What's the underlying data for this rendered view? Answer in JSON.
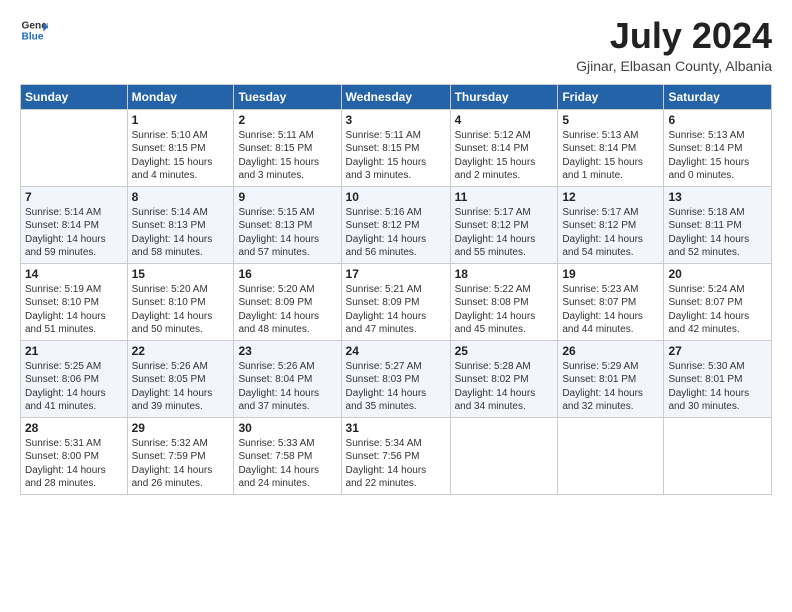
{
  "header": {
    "logo_general": "General",
    "logo_blue": "Blue",
    "month_year": "July 2024",
    "location": "Gjinar, Elbasan County, Albania"
  },
  "weekdays": [
    "Sunday",
    "Monday",
    "Tuesday",
    "Wednesday",
    "Thursday",
    "Friday",
    "Saturday"
  ],
  "weeks": [
    [
      {
        "day": "",
        "sunrise": "",
        "sunset": "",
        "daylight": ""
      },
      {
        "day": "1",
        "sunrise": "Sunrise: 5:10 AM",
        "sunset": "Sunset: 8:15 PM",
        "daylight": "Daylight: 15 hours and 4 minutes."
      },
      {
        "day": "2",
        "sunrise": "Sunrise: 5:11 AM",
        "sunset": "Sunset: 8:15 PM",
        "daylight": "Daylight: 15 hours and 3 minutes."
      },
      {
        "day": "3",
        "sunrise": "Sunrise: 5:11 AM",
        "sunset": "Sunset: 8:15 PM",
        "daylight": "Daylight: 15 hours and 3 minutes."
      },
      {
        "day": "4",
        "sunrise": "Sunrise: 5:12 AM",
        "sunset": "Sunset: 8:14 PM",
        "daylight": "Daylight: 15 hours and 2 minutes."
      },
      {
        "day": "5",
        "sunrise": "Sunrise: 5:13 AM",
        "sunset": "Sunset: 8:14 PM",
        "daylight": "Daylight: 15 hours and 1 minute."
      },
      {
        "day": "6",
        "sunrise": "Sunrise: 5:13 AM",
        "sunset": "Sunset: 8:14 PM",
        "daylight": "Daylight: 15 hours and 0 minutes."
      }
    ],
    [
      {
        "day": "7",
        "sunrise": "Sunrise: 5:14 AM",
        "sunset": "Sunset: 8:14 PM",
        "daylight": "Daylight: 14 hours and 59 minutes."
      },
      {
        "day": "8",
        "sunrise": "Sunrise: 5:14 AM",
        "sunset": "Sunset: 8:13 PM",
        "daylight": "Daylight: 14 hours and 58 minutes."
      },
      {
        "day": "9",
        "sunrise": "Sunrise: 5:15 AM",
        "sunset": "Sunset: 8:13 PM",
        "daylight": "Daylight: 14 hours and 57 minutes."
      },
      {
        "day": "10",
        "sunrise": "Sunrise: 5:16 AM",
        "sunset": "Sunset: 8:12 PM",
        "daylight": "Daylight: 14 hours and 56 minutes."
      },
      {
        "day": "11",
        "sunrise": "Sunrise: 5:17 AM",
        "sunset": "Sunset: 8:12 PM",
        "daylight": "Daylight: 14 hours and 55 minutes."
      },
      {
        "day": "12",
        "sunrise": "Sunrise: 5:17 AM",
        "sunset": "Sunset: 8:12 PM",
        "daylight": "Daylight: 14 hours and 54 minutes."
      },
      {
        "day": "13",
        "sunrise": "Sunrise: 5:18 AM",
        "sunset": "Sunset: 8:11 PM",
        "daylight": "Daylight: 14 hours and 52 minutes."
      }
    ],
    [
      {
        "day": "14",
        "sunrise": "Sunrise: 5:19 AM",
        "sunset": "Sunset: 8:10 PM",
        "daylight": "Daylight: 14 hours and 51 minutes."
      },
      {
        "day": "15",
        "sunrise": "Sunrise: 5:20 AM",
        "sunset": "Sunset: 8:10 PM",
        "daylight": "Daylight: 14 hours and 50 minutes."
      },
      {
        "day": "16",
        "sunrise": "Sunrise: 5:20 AM",
        "sunset": "Sunset: 8:09 PM",
        "daylight": "Daylight: 14 hours and 48 minutes."
      },
      {
        "day": "17",
        "sunrise": "Sunrise: 5:21 AM",
        "sunset": "Sunset: 8:09 PM",
        "daylight": "Daylight: 14 hours and 47 minutes."
      },
      {
        "day": "18",
        "sunrise": "Sunrise: 5:22 AM",
        "sunset": "Sunset: 8:08 PM",
        "daylight": "Daylight: 14 hours and 45 minutes."
      },
      {
        "day": "19",
        "sunrise": "Sunrise: 5:23 AM",
        "sunset": "Sunset: 8:07 PM",
        "daylight": "Daylight: 14 hours and 44 minutes."
      },
      {
        "day": "20",
        "sunrise": "Sunrise: 5:24 AM",
        "sunset": "Sunset: 8:07 PM",
        "daylight": "Daylight: 14 hours and 42 minutes."
      }
    ],
    [
      {
        "day": "21",
        "sunrise": "Sunrise: 5:25 AM",
        "sunset": "Sunset: 8:06 PM",
        "daylight": "Daylight: 14 hours and 41 minutes."
      },
      {
        "day": "22",
        "sunrise": "Sunrise: 5:26 AM",
        "sunset": "Sunset: 8:05 PM",
        "daylight": "Daylight: 14 hours and 39 minutes."
      },
      {
        "day": "23",
        "sunrise": "Sunrise: 5:26 AM",
        "sunset": "Sunset: 8:04 PM",
        "daylight": "Daylight: 14 hours and 37 minutes."
      },
      {
        "day": "24",
        "sunrise": "Sunrise: 5:27 AM",
        "sunset": "Sunset: 8:03 PM",
        "daylight": "Daylight: 14 hours and 35 minutes."
      },
      {
        "day": "25",
        "sunrise": "Sunrise: 5:28 AM",
        "sunset": "Sunset: 8:02 PM",
        "daylight": "Daylight: 14 hours and 34 minutes."
      },
      {
        "day": "26",
        "sunrise": "Sunrise: 5:29 AM",
        "sunset": "Sunset: 8:01 PM",
        "daylight": "Daylight: 14 hours and 32 minutes."
      },
      {
        "day": "27",
        "sunrise": "Sunrise: 5:30 AM",
        "sunset": "Sunset: 8:01 PM",
        "daylight": "Daylight: 14 hours and 30 minutes."
      }
    ],
    [
      {
        "day": "28",
        "sunrise": "Sunrise: 5:31 AM",
        "sunset": "Sunset: 8:00 PM",
        "daylight": "Daylight: 14 hours and 28 minutes."
      },
      {
        "day": "29",
        "sunrise": "Sunrise: 5:32 AM",
        "sunset": "Sunset: 7:59 PM",
        "daylight": "Daylight: 14 hours and 26 minutes."
      },
      {
        "day": "30",
        "sunrise": "Sunrise: 5:33 AM",
        "sunset": "Sunset: 7:58 PM",
        "daylight": "Daylight: 14 hours and 24 minutes."
      },
      {
        "day": "31",
        "sunrise": "Sunrise: 5:34 AM",
        "sunset": "Sunset: 7:56 PM",
        "daylight": "Daylight: 14 hours and 22 minutes."
      },
      {
        "day": "",
        "sunrise": "",
        "sunset": "",
        "daylight": ""
      },
      {
        "day": "",
        "sunrise": "",
        "sunset": "",
        "daylight": ""
      },
      {
        "day": "",
        "sunrise": "",
        "sunset": "",
        "daylight": ""
      }
    ]
  ]
}
